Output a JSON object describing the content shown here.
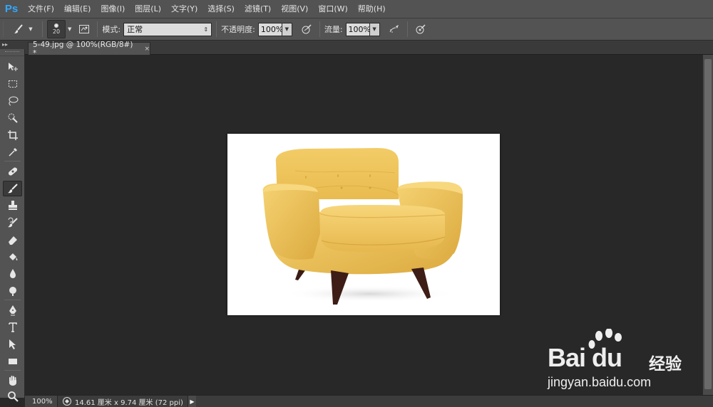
{
  "app": {
    "logo": "Ps"
  },
  "menu": [
    "文件(F)",
    "编辑(E)",
    "图像(I)",
    "图层(L)",
    "文字(Y)",
    "选择(S)",
    "滤镜(T)",
    "视图(V)",
    "窗口(W)",
    "帮助(H)"
  ],
  "options": {
    "brush_size": "20",
    "mode_label": "模式:",
    "mode_value": "正常",
    "opacity_label": "不透明度:",
    "opacity_value": "100%",
    "flow_label": "流量:",
    "flow_value": "100%"
  },
  "document_tab": {
    "title": "5-49.jpg @ 100%(RGB/8#) *",
    "close": "×"
  },
  "toolbox": {
    "tools": [
      "move-tool",
      "marquee-tool",
      "lasso-tool",
      "quick-selection-tool",
      "crop-tool",
      "eyedropper-tool",
      "healing-brush-tool",
      "brush-tool",
      "clone-stamp-tool",
      "history-brush-tool",
      "eraser-tool",
      "paint-bucket-tool",
      "blur-tool",
      "dodge-tool",
      "pen-tool",
      "type-tool",
      "path-selection-tool",
      "rectangle-tool",
      "hand-tool",
      "zoom-tool"
    ],
    "active": "brush-tool"
  },
  "canvas": {
    "image_subject": "yellow-armchair",
    "background": "#ffffff"
  },
  "status": {
    "zoom": "100%",
    "doc_info": "14.61 厘米 x 9.74 厘米 (72 ppi)"
  },
  "watermark": {
    "brand": "Bai du",
    "brand_cn": "经验",
    "url": "jingyan.baidu.com"
  },
  "colors": {
    "ui_dark": "#282828",
    "ui_mid": "#535353",
    "ps_blue": "#31a8ff",
    "sofa": "#f1c75d"
  }
}
